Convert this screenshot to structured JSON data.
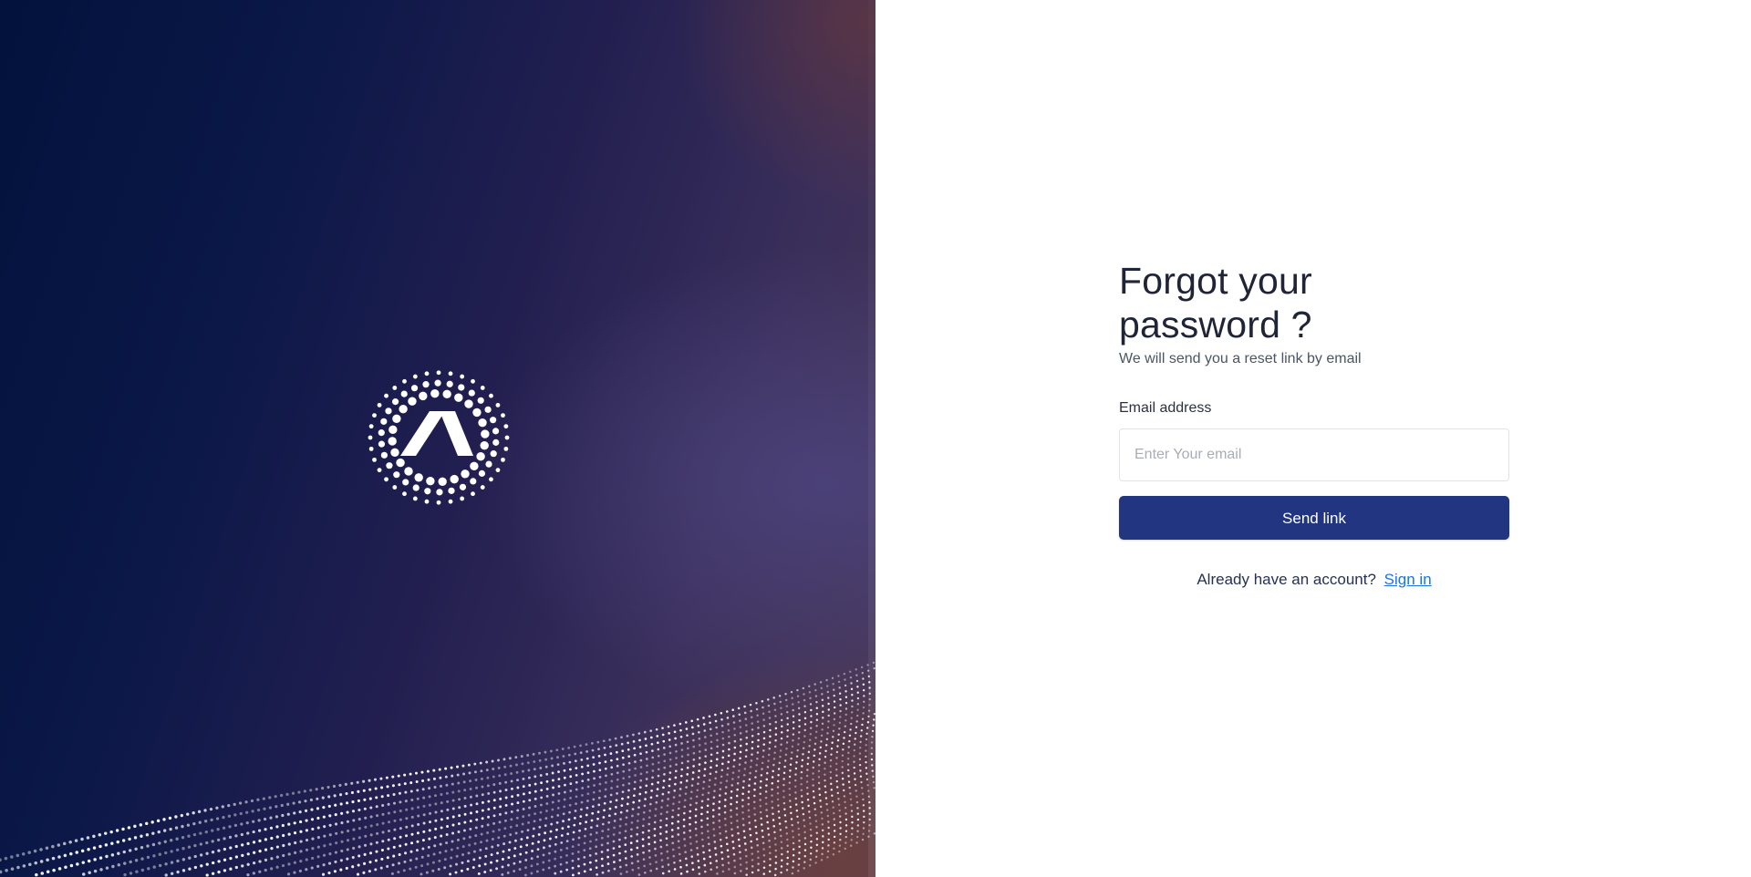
{
  "brand": {
    "logo_icon": "dotted-circle-chevron-logo",
    "wave_icon": "dotted-wave-pattern",
    "accent_color": "#223580",
    "link_color": "#1d72e8"
  },
  "forgot_password": {
    "title_line_1": "Forgot your",
    "title_line_2": "password ?",
    "subtitle": "We will send you a reset link by email",
    "email_label": "Email address",
    "email_placeholder": "Enter Your email",
    "email_value": "",
    "send_button_label": "Send link",
    "signin_prompt": "Already have an account?",
    "signin_link_label": "Sign in"
  }
}
